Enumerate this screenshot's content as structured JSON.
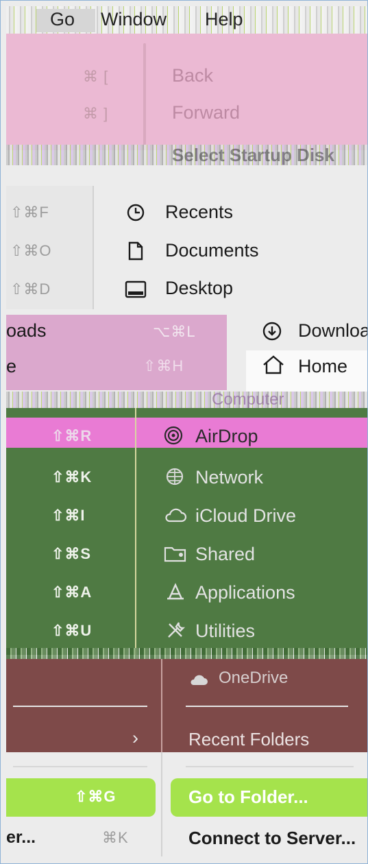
{
  "menubar": {
    "go": "Go",
    "window": "Window",
    "help": "Help"
  },
  "nav": {
    "back": {
      "label": "Back",
      "shortcut": "⌘ ["
    },
    "forward": {
      "label": "Forward",
      "shortcut": "⌘ ]"
    },
    "select_startup": {
      "label": "Select Startup Disk",
      "shortcut": "⇧⌘↑"
    }
  },
  "places": [
    {
      "label": "Recents",
      "shortcut": "⇧⌘F",
      "icon": "clock-icon"
    },
    {
      "label": "Documents",
      "shortcut": "⇧⌘O",
      "icon": "document-icon"
    },
    {
      "label": "Desktop",
      "shortcut": "⇧⌘D",
      "icon": "desktop-icon"
    }
  ],
  "mid": {
    "downloads": {
      "label": "Downloads",
      "left_fragment": "oads",
      "shortcut": "⌥⌘L",
      "icon": "download-icon"
    },
    "home": {
      "label": "Home",
      "left_fragment": "e",
      "shortcut": "⇧⌘H",
      "icon": "home-icon"
    },
    "computer": {
      "label": "Computer"
    }
  },
  "locations": [
    {
      "label": "AirDrop",
      "shortcut": "⇧⌘R",
      "icon": "airdrop-icon"
    },
    {
      "label": "Network",
      "shortcut": "⇧⌘K",
      "icon": "network-icon"
    },
    {
      "label": "iCloud Drive",
      "shortcut": "⇧⌘I",
      "icon": "cloud-icon"
    },
    {
      "label": "Shared",
      "shortcut": "⇧⌘S",
      "icon": "shared-folder-icon"
    },
    {
      "label": "Applications",
      "shortcut": "⇧⌘A",
      "icon": "applications-icon"
    },
    {
      "label": "Utilities",
      "shortcut": "⇧⌘U",
      "icon": "utilities-icon"
    }
  ],
  "lower": {
    "onedrive": {
      "label": "OneDrive"
    },
    "recent_folders": {
      "label": "Recent Folders",
      "chevron": "›"
    },
    "go_to_folder": {
      "label": "Go to Folder...",
      "shortcut": "⇧⌘G"
    },
    "connect_server": {
      "label": "Connect to Server...",
      "left_fragment": "er...",
      "shortcut": "⌘K"
    }
  },
  "colors": {
    "pink": "#ebb9d3",
    "green": "#4f7a43",
    "brown": "#7e4a49",
    "highlight": "#a5e34c",
    "frame_border": "#8fb3d6"
  }
}
